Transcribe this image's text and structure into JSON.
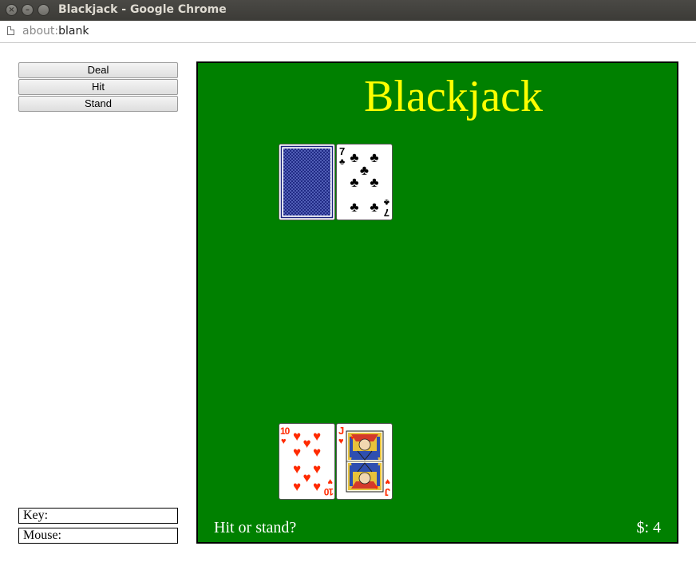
{
  "window": {
    "title": "Blackjack - Google Chrome"
  },
  "address": {
    "scheme": "about:",
    "host": "blank"
  },
  "controls": {
    "deal": "Deal",
    "hit": "Hit",
    "stand": "Stand"
  },
  "status": {
    "key_label": "Key:",
    "mouse_label": "Mouse:"
  },
  "game": {
    "title": "Blackjack",
    "message": "Hit or stand?",
    "money": "$: 4",
    "dealer_hand": [
      {
        "face": "down",
        "back_color": "#1a237e"
      },
      {
        "face": "up",
        "rank": "7",
        "suit": "clubs",
        "color": "#000000"
      }
    ],
    "player_hand": [
      {
        "face": "up",
        "rank": "10",
        "suit": "hearts",
        "color": "#ff2a00"
      },
      {
        "face": "up",
        "rank": "J",
        "suit": "hearts",
        "color": "#ff2a00"
      }
    ]
  },
  "colors": {
    "table": "#008000",
    "title": "#ffff00",
    "text": "#ffffff"
  }
}
